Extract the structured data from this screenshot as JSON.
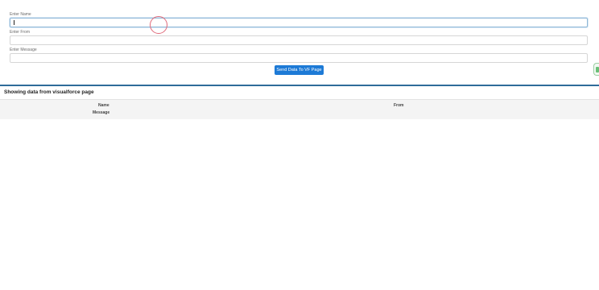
{
  "form": {
    "name_label": "Enter Name",
    "from_label": "Enter From",
    "message_label": "Enter Message",
    "name_value": "",
    "from_value": "",
    "message_value": "",
    "submit_label": "Send Data To VF Page"
  },
  "output": {
    "title": "Showing data from visualforce page",
    "columns": [
      "Name",
      "From",
      "Message"
    ]
  }
}
